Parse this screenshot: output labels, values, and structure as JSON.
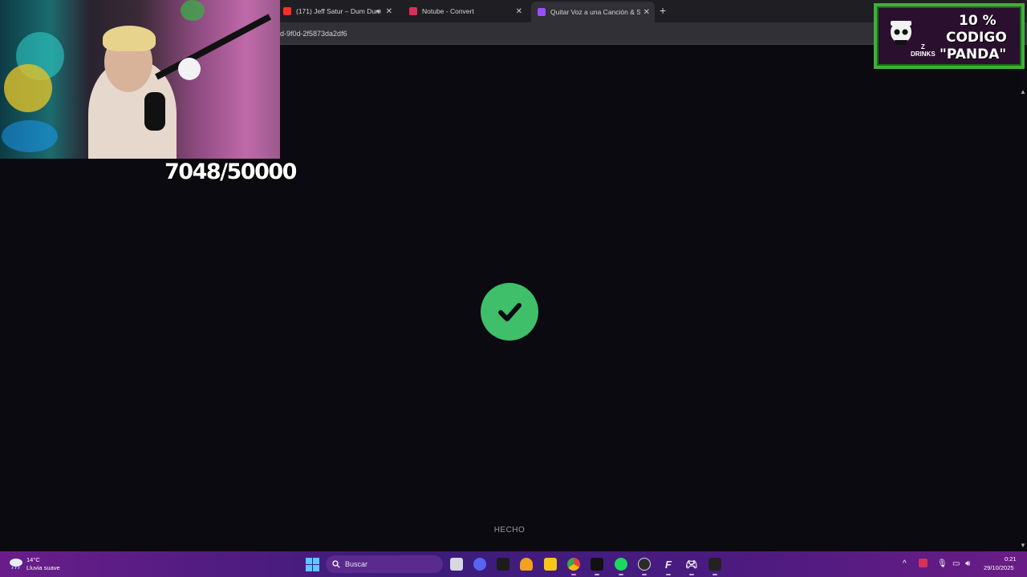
{
  "browser": {
    "tabs": [
      {
        "title": "(171) Jeff Satur – Dum Dum",
        "audio_icon": "speaker-icon",
        "close": "✕",
        "favicon_color": "#ff2d2d"
      },
      {
        "title": "Notube - Convert",
        "close": "✕",
        "favicon_color": "#d9305a"
      },
      {
        "title": "Quitar Voz a una Canción & Se",
        "close": "✕",
        "favicon_color": "#9b4dff",
        "active": true
      }
    ],
    "new_tab": "+",
    "url": "d-9f0d-2f5873da2df6"
  },
  "page": {
    "status_icon": "check-icon",
    "status_color": "#3fbf6a",
    "status_label": "HECHO"
  },
  "stream_overlay": {
    "counter": "7048/50000",
    "promo": {
      "line1": "10 %",
      "line2": "CODIGO",
      "line3": "\"PANDA\"",
      "brand_top": "Z",
      "brand_bottom": "DRINKS"
    }
  },
  "taskbar": {
    "weather": {
      "temp": "14°C",
      "desc": "Lluvia suave",
      "icon": "cloud-rain-icon"
    },
    "search_label": "Buscar",
    "apps": [
      "task-view",
      "discord",
      "capcut",
      "fl-studio",
      "file-explorer",
      "chrome",
      "waves",
      "spotify",
      "obs",
      "text-app",
      "xbox",
      "epic-games"
    ],
    "clock": {
      "time": "0:21",
      "date": "29/10/2025"
    }
  }
}
